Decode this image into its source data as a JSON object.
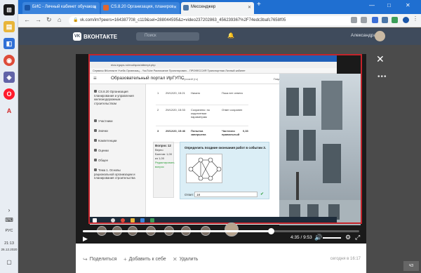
{
  "taskbar": {
    "lang": "РУС",
    "time": "21:13",
    "date": "26.12.2020"
  },
  "browser": {
    "tabs": [
      {
        "label": "БИС - Личный кабинет обучающ",
        "color": "#1a56a8"
      },
      {
        "label": "CS.8.20 Организация, планиров",
        "color": "#e0662f"
      },
      {
        "label": "Мессенджер",
        "color": "#4a76a8"
      }
    ],
    "url": "vk.com/im?peers=164387708_c119&sel=288044595&z=video237202863_456239367%2F74edc3bafc7658f05",
    "window_controls": [
      "—",
      "□",
      "✕"
    ]
  },
  "vk": {
    "logo": "ВКОНТАКТЕ",
    "search_placeholder": "Поиск",
    "user_name": "Александра"
  },
  "video": {
    "recorded": {
      "address": "eios.irgups.ru/mod/quiz/attempt.php",
      "bookmarks": "Сервисы  ВКонтакте  Учеба  Организац...  YouTube  Расписание  Проектирован...  ПРОФЕССИЯ  Транспортная  Личный кабинет",
      "portal_title": "Образовательный портал ИрГУПС",
      "lang": "Русский (ru)",
      "user": "Гладкова Ольга Анатольевна",
      "sidebar": [
        "CS.8.20 Организация планирования и управления железнодорожным строительством",
        "Участники",
        "Значки",
        "Компетенции",
        "Оценки",
        "Общее",
        "Тема 1. Основы рациональной организации и планирования строительства"
      ],
      "table_rows": [
        {
          "n": "1",
          "date": "29/12/20, 15:21",
          "state": "Начато",
          "mark": "Пока нет ответа",
          "score": ""
        },
        {
          "n": "2",
          "date": "29/12/20, 15:33",
          "state": "Сохранено: по корректным параметрам",
          "mark": "Ответ сохранен",
          "score": ""
        },
        {
          "n": "3",
          "date": "29/12/20, 15:46",
          "state": "Попытка завершена",
          "mark": "Частично правильный",
          "score": "0,33"
        }
      ],
      "question_info": {
        "title": "Вопрос 12",
        "state": "Верно",
        "points": "Баллов: 1,00 из 1,00",
        "edit": "Редактировать вопрос"
      },
      "question_text": "Определить поздние окончания работ в событии 3.",
      "answer_label": "Ответ:",
      "answer_value": "18"
    },
    "player": {
      "progress": 0.68,
      "time": "4:35 / 9:53",
      "play_icon": "play-icon"
    }
  },
  "bottom": {
    "share": "Поделиться",
    "add": "Добавить к себе",
    "delete": "Удалить",
    "date": "сегодня в 16:17"
  },
  "corner_badge": "ЧЗ"
}
